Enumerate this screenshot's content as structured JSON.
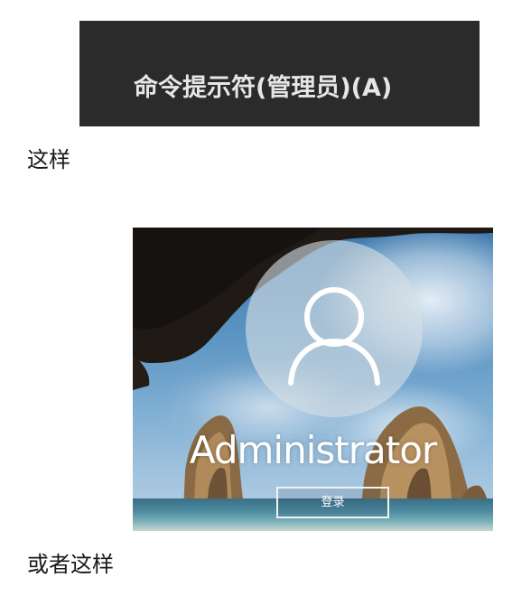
{
  "context_menu": {
    "item_label": "命令提示符(管理员)(A)"
  },
  "captions": {
    "first": "这样",
    "second": "或者这样"
  },
  "login_screen": {
    "username": "Administrator",
    "signin_label": "登录",
    "avatar_icon": "user-icon"
  },
  "colors": {
    "menu_background": "#2b2b2b",
    "menu_text": "#e6e6e6",
    "avatar_circle": "#d7dee4"
  }
}
